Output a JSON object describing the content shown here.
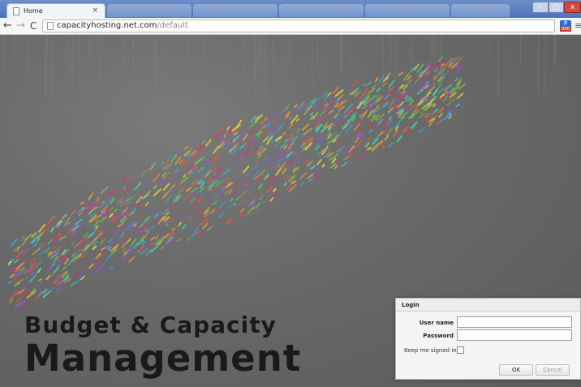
{
  "browser": {
    "active_tab": {
      "title": "Home",
      "close": "×"
    },
    "nav": {
      "back": "←",
      "forward": "→",
      "reload": "C"
    },
    "address": {
      "host": "capacityhosting.net.com",
      "path": "/default"
    },
    "extension_badge": {
      "top": "P",
      "bottom": "BBB"
    },
    "menu": "≡",
    "window_controls": {
      "minimize": "–",
      "maximize": "□",
      "close": "x"
    }
  },
  "page": {
    "headline_line1": "Budget & Capacity",
    "headline_line2": "Management"
  },
  "login": {
    "title": "Login",
    "username_label": "User name",
    "password_label": "Password",
    "username_value": "",
    "password_value": "",
    "keep_signed_in_label": "Keep me signed in",
    "keep_signed_in_checked": false,
    "ok_label": "OK",
    "cancel_label": "Cancel"
  },
  "colors": {
    "accent_blue": "#4d72b8",
    "background_gray": "#5e5e5e",
    "headline": "#1a1a1a"
  }
}
